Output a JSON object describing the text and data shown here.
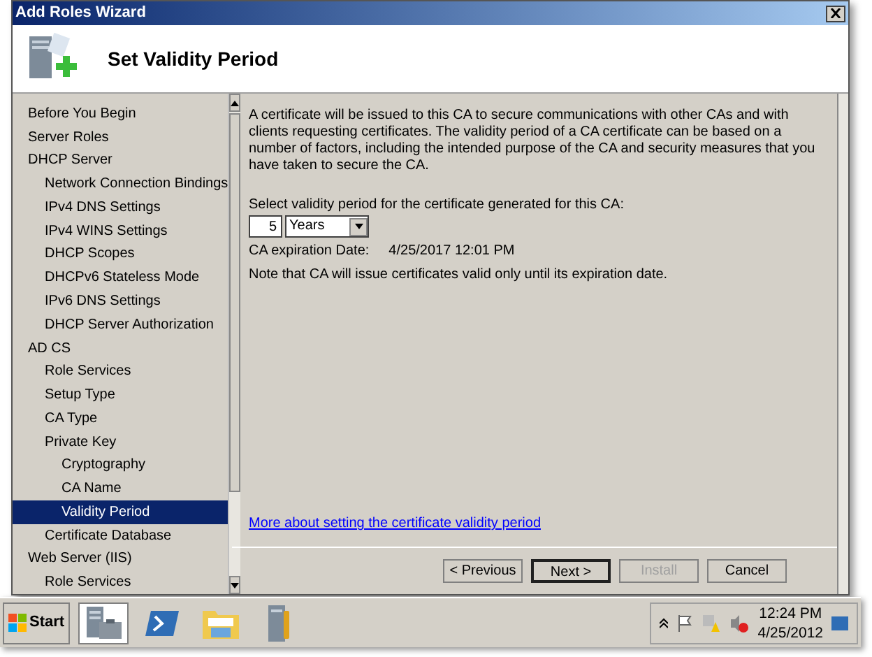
{
  "window": {
    "title": "Add Roles Wizard",
    "heading": "Set Validity Period"
  },
  "nav": [
    {
      "label": "Before You Begin",
      "selected": false
    },
    {
      "label": "Server Roles",
      "selected": false
    },
    {
      "label": "DHCP Server",
      "selected": false,
      "children": [
        {
          "label": "Network Connection Bindings",
          "selected": false
        },
        {
          "label": "IPv4 DNS Settings",
          "selected": false
        },
        {
          "label": "IPv4 WINS Settings",
          "selected": false
        },
        {
          "label": "DHCP Scopes",
          "selected": false
        },
        {
          "label": "DHCPv6 Stateless Mode",
          "selected": false
        },
        {
          "label": "IPv6 DNS Settings",
          "selected": false
        },
        {
          "label": "DHCP Server Authorization",
          "selected": false
        }
      ]
    },
    {
      "label": "AD CS",
      "selected": false,
      "children": [
        {
          "label": "Role Services",
          "selected": false
        },
        {
          "label": "Setup Type",
          "selected": false
        },
        {
          "label": "CA Type",
          "selected": false
        },
        {
          "label": "Private Key",
          "selected": false,
          "children": [
            {
              "label": "Cryptography",
              "selected": false
            },
            {
              "label": "CA Name",
              "selected": false
            },
            {
              "label": "Validity Period",
              "selected": true
            }
          ]
        },
        {
          "label": "Certificate Database",
          "selected": false
        }
      ]
    },
    {
      "label": "Web Server (IIS)",
      "selected": false,
      "children": [
        {
          "label": "Role Services",
          "selected": false
        }
      ]
    }
  ],
  "content": {
    "description": "A certificate will be issued to this CA to secure communications with other CAs and with clients requesting certificates. The validity period of a CA certificate can be based on a number of factors, including the intended purpose of the CA and security measures that you have taken to secure the CA.",
    "period_label": "Select validity period for the certificate generated for this CA:",
    "period_value": "5",
    "period_unit": "Years",
    "expiration_label": "CA expiration Date:",
    "expiration_value": "4/25/2017 12:01 PM",
    "note": "Note that CA will issue certificates valid only until its expiration date.",
    "link": "More about setting the certificate validity period"
  },
  "buttons": [
    {
      "label": "< Previous",
      "disabled": false,
      "default": false
    },
    {
      "label": "Next >",
      "disabled": false,
      "default": true
    },
    {
      "label": "Install",
      "disabled": true,
      "default": false
    },
    {
      "label": "Cancel",
      "disabled": false,
      "default": false
    }
  ],
  "taskbar": {
    "start": "Start",
    "apps": [
      {
        "kind": "server-manager",
        "selected": true
      },
      {
        "kind": "powershell",
        "selected": false
      },
      {
        "kind": "explorer",
        "selected": false
      },
      {
        "kind": "tools",
        "selected": false
      }
    ],
    "time": "12:24 PM",
    "date": "4/25/2012"
  }
}
